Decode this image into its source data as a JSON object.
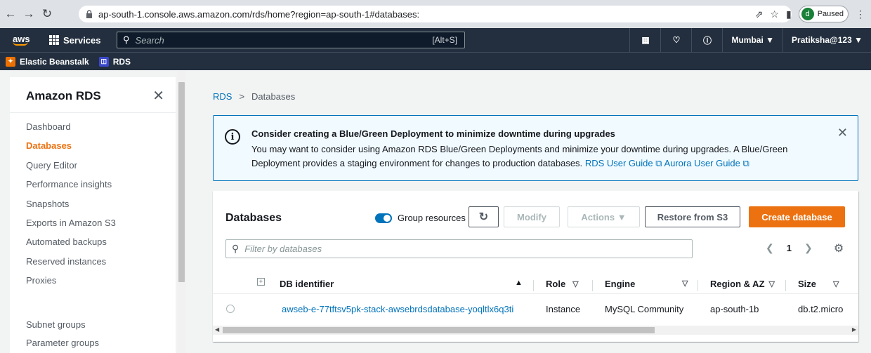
{
  "browser": {
    "url": "ap-south-1.console.aws.amazon.com/rds/home?region=ap-south-1#databases:",
    "profile_initial": "d",
    "profile_status": "Paused"
  },
  "aws_header": {
    "logo": "aws",
    "services_label": "Services",
    "search_placeholder": "Search",
    "search_shortcut": "[Alt+S]",
    "region": "Mumbai ▼",
    "account": "Pratiksha@123 ▼"
  },
  "favorites": [
    {
      "label": "Elastic Beanstalk",
      "color": "#ed7100"
    },
    {
      "label": "RDS",
      "color": "#3b48cc"
    }
  ],
  "sidebar": {
    "title": "Amazon RDS",
    "items": [
      {
        "label": "Dashboard",
        "active": false
      },
      {
        "label": "Databases",
        "active": true
      },
      {
        "label": "Query Editor",
        "active": false
      },
      {
        "label": "Performance insights",
        "active": false
      },
      {
        "label": "Snapshots",
        "active": false
      },
      {
        "label": "Exports in Amazon S3",
        "active": false
      },
      {
        "label": "Automated backups",
        "active": false
      },
      {
        "label": "Reserved instances",
        "active": false
      },
      {
        "label": "Proxies",
        "active": false
      }
    ],
    "items2": [
      {
        "label": "Subnet groups"
      },
      {
        "label": "Parameter groups"
      }
    ]
  },
  "breadcrumb": {
    "root": "RDS",
    "separator": ">",
    "current": "Databases"
  },
  "alert": {
    "title": "Consider creating a Blue/Green Deployment to minimize downtime during upgrades",
    "body": "You may want to consider using Amazon RDS Blue/Green Deployments and minimize your downtime during upgrades. A Blue/Green Deployment provides a staging environment for changes to production databases.",
    "link1": "RDS User Guide",
    "link2": "Aurora User Guide"
  },
  "databases": {
    "title": "Databases",
    "group_resources_label": "Group resources",
    "modify_label": "Modify",
    "actions_label": "Actions ▼",
    "restore_label": "Restore from S3",
    "create_label": "Create database",
    "filter_placeholder": "Filter by databases",
    "page": "1",
    "columns": {
      "identifier": "DB identifier",
      "role": "Role",
      "engine": "Engine",
      "region": "Region & AZ",
      "size": "Size"
    },
    "rows": [
      {
        "identifier": "awseb-e-77tftsv5pk-stack-awsebrdsdatabase-yoqltlx6q3ti",
        "role": "Instance",
        "engine": "MySQL Community",
        "region": "ap-south-1b",
        "size": "db.t2.micro"
      }
    ]
  },
  "colors": {
    "aws_header": "#232f3e",
    "accent_orange": "#ec7211",
    "link_blue": "#0073bb"
  }
}
